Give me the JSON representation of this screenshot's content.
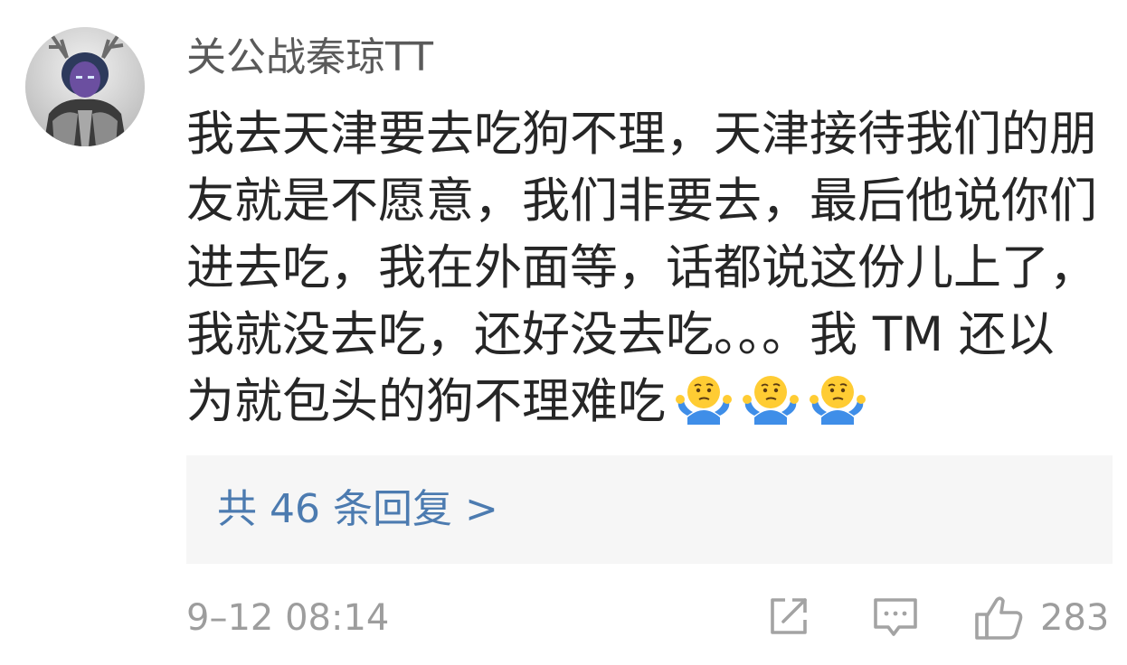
{
  "comment": {
    "username": "关公战秦琼TT",
    "text": "我去天津要去吃狗不理，天津接待我们的朋友就是不愿意，我们非要去，最后他说你们进去吃，我在外面等，话都说这份儿上了，我就没去吃，还好没去吃。。。我 TM 还以为就包头的狗不理难吃",
    "emojis": [
      "shrug-emoji",
      "shrug-emoji",
      "shrug-emoji"
    ],
    "replies_label": "共 46 条回复 >",
    "timestamp": "9–12 08:14",
    "like_count": "283"
  },
  "icons": {
    "share": "share-icon",
    "comment": "comment-icon",
    "like": "thumbs-up-icon"
  },
  "colors": {
    "username": "#5a5a5a",
    "text": "#262626",
    "link": "#4c7bb0",
    "meta": "#9d9d9d",
    "reply_bg": "#f6f6f6",
    "emoji_face": "#ffcc33",
    "emoji_shirt": "#3f8ee8"
  }
}
